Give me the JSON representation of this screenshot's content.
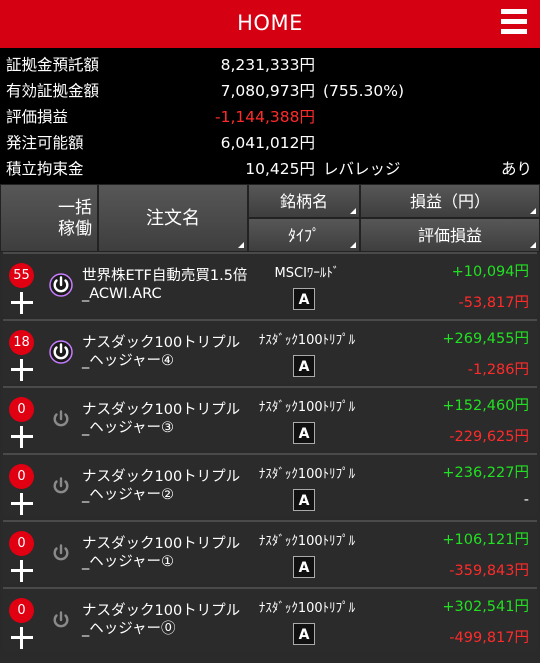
{
  "header": {
    "title": "HOME"
  },
  "summary": {
    "rows": [
      {
        "label": "証拠金預託額",
        "value": "8,231,333円"
      },
      {
        "label": "有効証拠金額",
        "value": "7,080,973円",
        "extra": "(755.30%)"
      },
      {
        "label": "評価損益",
        "value": "-1,144,388円"
      },
      {
        "label": "発注可能額",
        "value": "6,041,012円"
      },
      {
        "label": "積立拘束金",
        "value": "10,425円",
        "extra": "レバレッジ",
        "extra2": "あり"
      }
    ]
  },
  "columns": {
    "ikkatsu_line1": "一括",
    "ikkatsu_line2": "稼働",
    "order_name": "注文名",
    "brand": "銘柄名",
    "type": "ﾀｲﾌﾟ",
    "pl": "損益（円）",
    "eval": "評価損益"
  },
  "orders": [
    {
      "count": "55",
      "active": true,
      "name1": "世界株ETF自動売買1.5倍",
      "name2": "_ACWI.ARC",
      "brand": "MSCIﾜｰﾙﾄﾞ",
      "type": "A",
      "pl": "+10,094円",
      "eval": "-53,817円"
    },
    {
      "count": "18",
      "active": true,
      "name1": "ナスダック100トリプル",
      "name2": "_ヘッジャー④",
      "brand": "ﾅｽﾀﾞｯｸ100ﾄﾘﾌﾟﾙ",
      "type": "A",
      "pl": "+269,455円",
      "eval": "-1,286円"
    },
    {
      "count": "0",
      "active": false,
      "name1": "ナスダック100トリプル",
      "name2": "_ヘッジャー③",
      "brand": "ﾅｽﾀﾞｯｸ100ﾄﾘﾌﾟﾙ",
      "type": "A",
      "pl": "+152,460円",
      "eval": "-229,625円"
    },
    {
      "count": "0",
      "active": false,
      "name1": "ナスダック100トリプル",
      "name2": "_ヘッジャー②",
      "brand": "ﾅｽﾀﾞｯｸ100ﾄﾘﾌﾟﾙ",
      "type": "A",
      "pl": "+236,227円",
      "eval": "-"
    },
    {
      "count": "0",
      "active": false,
      "name1": "ナスダック100トリプル",
      "name2": "_ヘッジャー①",
      "brand": "ﾅｽﾀﾞｯｸ100ﾄﾘﾌﾟﾙ",
      "type": "A",
      "pl": "+106,121円",
      "eval": "-359,843円"
    },
    {
      "count": "0",
      "active": false,
      "name1": "ナスダック100トリプル",
      "name2": "_ヘッジャー⓪",
      "brand": "ﾅｽﾀﾞｯｸ100ﾄﾘﾌﾟﾙ",
      "type": "A",
      "pl": "+302,541円",
      "eval": "-499,817円"
    }
  ],
  "colors": {
    "header_bg": "#d50012",
    "positive": "#22e022",
    "negative": "#ff2b2b",
    "power_active": "#c77dff",
    "power_inactive": "#8a8a8a"
  }
}
